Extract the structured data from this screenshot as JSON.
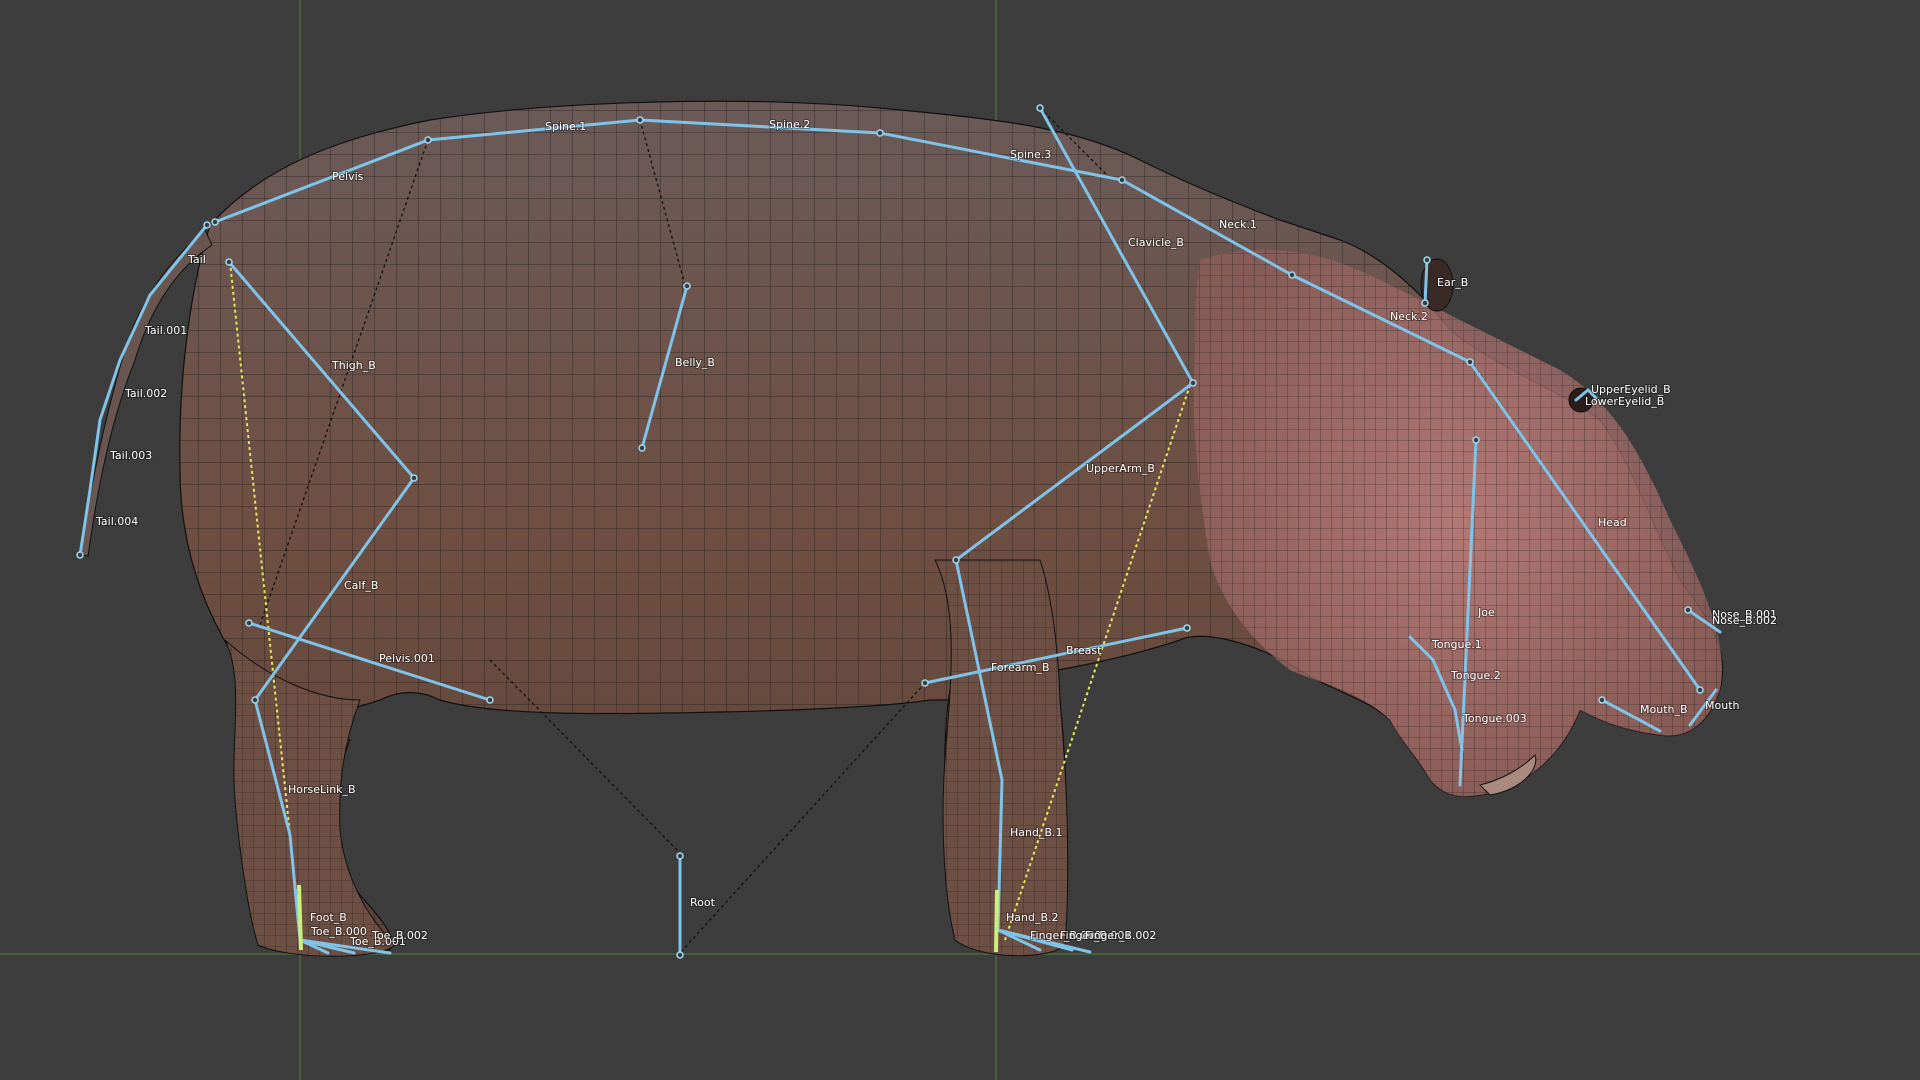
{
  "viewport": {
    "background": "#3d3d3d",
    "grid_axis_color": "#4b6b3b",
    "mesh_fill": "#6e5247",
    "mesh_head_fill": "#b77a7a",
    "wire_color": "#101010",
    "bone_color": "#7fc4e8",
    "ik_line_color": "#e6e65a",
    "selected_bone_color": "#c8f07a"
  },
  "bones": {
    "spine_1": "Spine.1",
    "spine_2": "Spine.2",
    "spine_3": "Spine.3",
    "pelvis": "Pelvis",
    "tail": "Tail",
    "tail_001": "Tail.001",
    "tail_002": "Tail.002",
    "tail_003": "Tail.003",
    "tail_004": "Tail.004",
    "thigh": "Thigh_B",
    "calf": "Calf_B",
    "pelvis_001": "Pelvis.001",
    "horselink": "HorseLink_B",
    "foot": "Foot_B",
    "toe_a": "Toe_B.000",
    "toe_b": "Toe_B.001",
    "toe_c": "Toe_B.002",
    "belly": "Belly_B",
    "root": "Root",
    "neck_1": "Neck.1",
    "neck_2": "Neck.2",
    "clavicle": "Clavicle_B",
    "upperarm": "UpperArm_B",
    "forearm": "Forearm_B",
    "breast": "Breast",
    "hand_1": "Hand_B.1",
    "hand_2": "Hand_B.2",
    "finger_a": "Finger_B.000",
    "finger_b": "Finger_B.001",
    "finger_c": "Finger_B.002",
    "ear": "Ear_B",
    "upper_eyelid": "UpperEyelid_B",
    "lower_eyelid": "LowerEyelid_B",
    "head": "Head",
    "jaw": "Joe",
    "tongue_1": "Tongue.1",
    "tongue_2": "Tongue.2",
    "tongue_3": "Tongue.003",
    "nose_1": "Nose_B.001",
    "nose_2": "Nose_B.002",
    "mouth_b": "Mouth_B",
    "mouth": "Mouth"
  }
}
